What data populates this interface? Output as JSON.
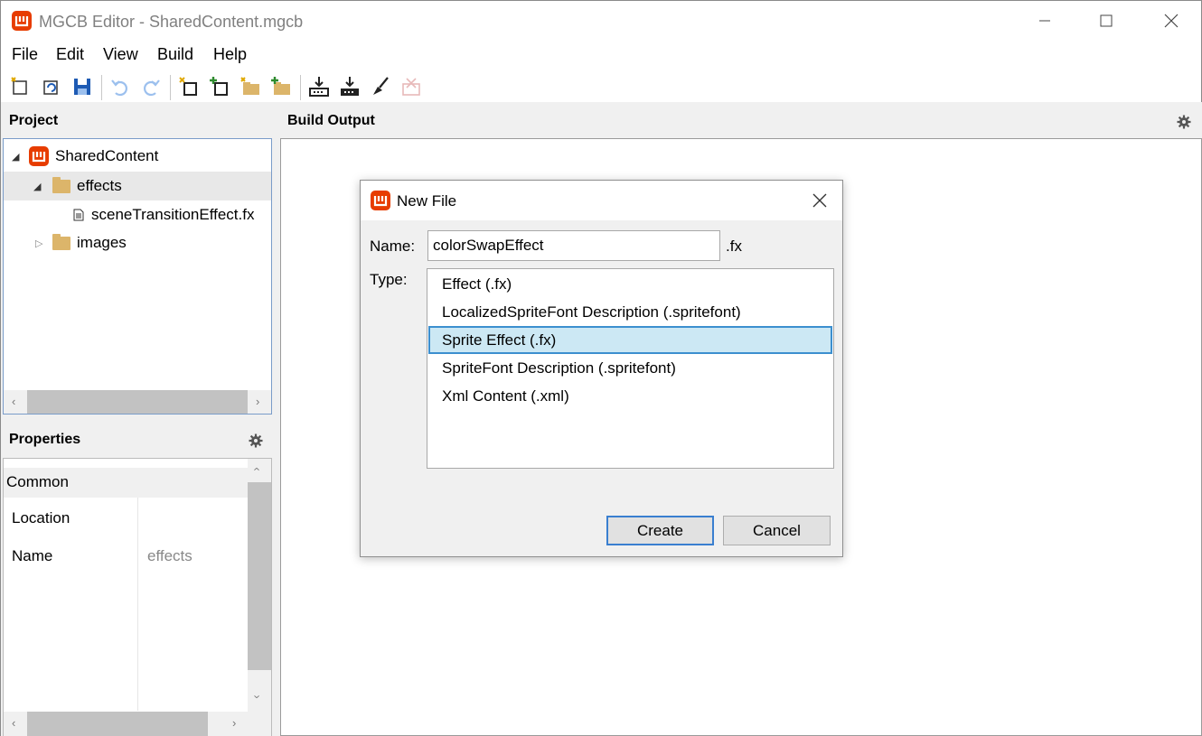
{
  "window": {
    "title": "MGCB Editor - SharedContent.mgcb",
    "logo_icon": "monogame-logo-icon",
    "brand_color": "#e73c00"
  },
  "menu": [
    "File",
    "Edit",
    "View",
    "Build",
    "Help"
  ],
  "toolbar": {
    "icons": [
      "new-project-icon",
      "open-project-icon",
      "save-icon",
      "undo-icon",
      "redo-icon",
      "new-item-icon",
      "add-existing-item-icon",
      "new-folder-icon",
      "add-existing-folder-icon",
      "build-icon",
      "rebuild-icon",
      "clean-icon",
      "cancel-build-icon"
    ]
  },
  "project": {
    "header": "Project",
    "tree": {
      "root": "SharedContent",
      "children": [
        {
          "label": "effects",
          "expanded": true,
          "children": [
            "sceneTransitionEffect.fx"
          ]
        },
        {
          "label": "images",
          "expanded": false
        }
      ]
    }
  },
  "properties": {
    "header": "Properties",
    "group": "Common",
    "rows": [
      {
        "name": "Location",
        "value": ""
      },
      {
        "name": "Name",
        "value": "effects"
      }
    ]
  },
  "build_output": {
    "header": "Build Output"
  },
  "dialog": {
    "title": "New File",
    "name_label": "Name:",
    "name_value": "colorSwapEffect",
    "extension": ".fx",
    "type_label": "Type:",
    "types": [
      "Effect (.fx)",
      "LocalizedSpriteFont Description (.spritefont)",
      "Sprite Effect (.fx)",
      "SpriteFont Description (.spritefont)",
      "Xml Content (.xml)"
    ],
    "selected_type": "Sprite Effect (.fx)",
    "create_label": "Create",
    "cancel_label": "Cancel"
  }
}
